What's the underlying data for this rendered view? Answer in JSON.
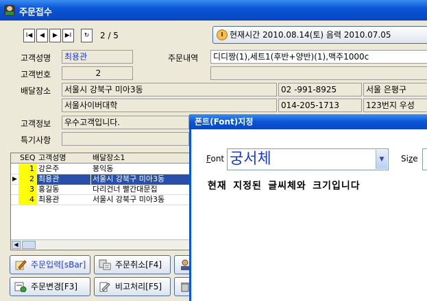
{
  "window": {
    "title": "주문접수"
  },
  "nav": {
    "first": "I◀",
    "prev": "◀",
    "next": "▶",
    "last": "▶I",
    "refresh": "↻",
    "counter": "2 / 5"
  },
  "time_button": {
    "label": "현재시간  2010.08.14(토) 음력  2010.07.05"
  },
  "form": {
    "name_label": "고객성명",
    "name_value": "최용관",
    "order_label": "주문내역",
    "order_value": "디디짱(1),세트1(후반+양반)(1),맥주1000c",
    "number_label": "고객번호",
    "number_value": "2",
    "address_label": "배달장소",
    "address1": "서울시 강북구 미아3동",
    "phone1": "02   -991-8925",
    "addr_extra1": "서울 은평구",
    "address2": "서울사이버대학",
    "phone2": "014-205-1713",
    "addr_extra2": "123번지 우성",
    "info_label": "고객정보",
    "info_value": "우수고객입니다.",
    "note_label": "특기사항",
    "note_value": ""
  },
  "grid": {
    "headers": [
      "SEQ",
      "고객성명",
      "배달장소1"
    ],
    "rows": [
      {
        "seq": "1",
        "name": "강은주",
        "addr": "봉익동"
      },
      {
        "seq": "2",
        "name": "최용관",
        "addr": "서울시 강북구 미아3동"
      },
      {
        "seq": "3",
        "name": "홍길동",
        "addr": "다리건너 빨간대문집"
      },
      {
        "seq": "4",
        "name": "최용관",
        "addr": "서울시 강북구 미아3동"
      }
    ],
    "row_marker": "▶"
  },
  "buttons": {
    "order_input": "주문입력[sBar]",
    "order_cancel": "주문취소[F4]",
    "order_change": "주문변경[F3]",
    "compare": "비고처리[F5]"
  },
  "font_dialog": {
    "title": "폰트(Font)지정",
    "font_label": "Font",
    "font_value": "궁서체",
    "size_label": "Size",
    "sample_text": "현재 지정된 글씨체와 크기입니다"
  },
  "colors": {
    "titlebar": "#0a56d8",
    "selection": "#2a4fa8",
    "seq_highlight": "#ffff00"
  }
}
